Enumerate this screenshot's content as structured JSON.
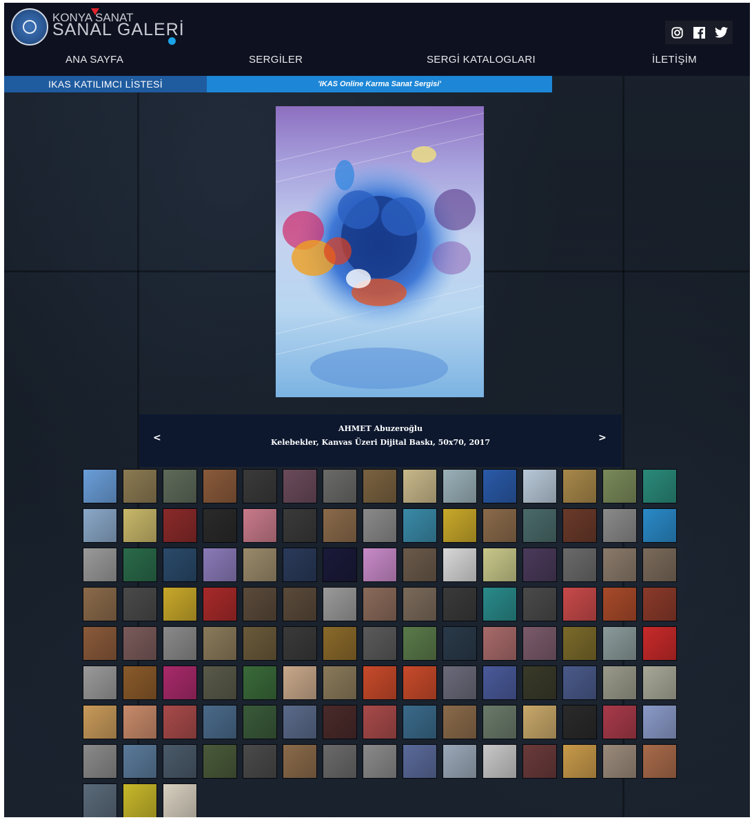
{
  "logo": {
    "line1": "KONYA SANAT",
    "line2": "SANAL GALERİ"
  },
  "social": [
    {
      "icon": "instagram-icon"
    },
    {
      "icon": "facebook-icon"
    },
    {
      "icon": "twitter-icon"
    }
  ],
  "nav": {
    "items": [
      "ANA SAYFA",
      "SERGİLER",
      "SERGİ KATALOGLARI",
      "İLETİŞİM"
    ]
  },
  "subbar": {
    "left_label": "IKAS KATILIMCI LİSTESİ",
    "right_label": "'IKAS Online Karma Sanat Sergisi'"
  },
  "artwork": {
    "artist": "AHMET Abuzeroğlu",
    "details": "Kelebekler, Kanvas Üzeri Dijital Baskı, 50x70, 2017",
    "prev_label": "<",
    "next_label": ">"
  },
  "thumbnails": {
    "count": 123,
    "colors": [
      "#6a9ed9",
      "#8b7a52",
      "#5e6a5a",
      "#8a5a3a",
      "#3a3a3a",
      "#6a4a5a",
      "#6a6a68",
      "#7a6240",
      "#c8b88a",
      "#9ab0b8",
      "#2a5aa8",
      "#b8c8d8",
      "#a8884a",
      "#7a8a5a",
      "#2a8a7a",
      "#8aa8c8",
      "#c8b86a",
      "#8a2a2a",
      "#2a2a2a",
      "#c87a8a",
      "#3a3a3a",
      "#8a6a4a",
      "#8a8a8a",
      "#3a8aa8",
      "#c8a82a",
      "#8a6a4a",
      "#4a6a6a",
      "#6a3a2a",
      "#8a8a8a",
      "#2a8ac8",
      "#9a9a9a",
      "#2a6a4a",
      "#2a4a6a",
      "#8a7ab8",
      "#9a8a6a",
      "#2a3a5a",
      "#1a1a3a",
      "#c88ac8",
      "#6a5a4a",
      "#d8d8d8",
      "#c8c88a",
      "#4a3a5a",
      "#6a6a6a",
      "#8a7a6a",
      "#7a6a5a",
      "#8a6a4a",
      "#4a4a4a",
      "#c8a82a",
      "#a82a2a",
      "#5a4a3a",
      "#5a4a3a",
      "#9a9a9a",
      "#8a6a5a",
      "#7a6a5a",
      "#3a3a3a",
      "#2a8a8a",
      "#4a4a4a",
      "#c84a4a",
      "#a84a2a",
      "#8a3a2a",
      "#8a5a3a",
      "#7a5a5a",
      "#8a8a8a",
      "#8a7a5a",
      "#6a5a3a",
      "#3a3a3a",
      "#8a6a2a",
      "#5a5a5a",
      "#5a7a4a",
      "#2a3a4a",
      "#a86a6a",
      "#7a5a6a",
      "#7a6a2a",
      "#8a9a9a",
      "#c82a2a",
      "#9a9a9a",
      "#8a5a2a",
      "#a82a6a",
      "#5a5a4a",
      "#3a6a3a",
      "#c8a88a",
      "#8a7a5a",
      "#c84a2a",
      "#c84a2a",
      "#6a6a7a",
      "#4a5a9a",
      "#3a3a2a",
      "#4a5a8a",
      "#9a9a8a",
      "#a8a898",
      "#c89a5a",
      "#c88a6a",
      "#a84a4a",
      "#4a6a8a",
      "#3a5a3a",
      "#5a6a8a",
      "#4a2a2a",
      "#a84a4a",
      "#3a6a8a",
      "#8a6a4a",
      "#6a7a6a",
      "#c8a86a",
      "#2a2a2a",
      "#a83a4a",
      "#8a9ac8",
      "#8a8a8a",
      "#5a7a9a",
      "#4a5a6a",
      "#4a5a3a",
      "#4a4a4a",
      "#8a6a4a",
      "#6a6a6a",
      "#8a8a8a",
      "#5a6a9a",
      "#9aa8b8",
      "#c8c8c8",
      "#6a3a3a",
      "#c89a4a",
      "#9a8a7a",
      "#a86a4a",
      "#5a6a7a",
      "#c8b82a",
      "#d8d0c0"
    ]
  }
}
